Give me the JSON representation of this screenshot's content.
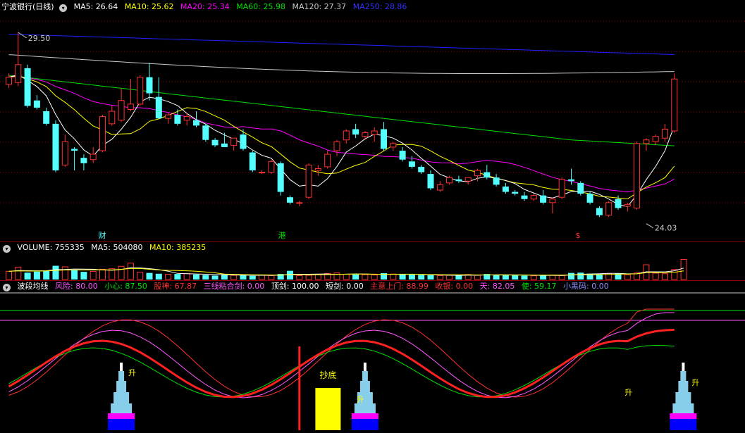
{
  "colors": {
    "bg": "#000000",
    "up": "#ff3232",
    "down": "#54ffff",
    "grid": "#8b0000",
    "ma5": "#ffffff",
    "ma10": "#ffff00",
    "ma20": "#ff00ff",
    "ma60": "#00e000",
    "ma120": "#c8c8c8",
    "ma250": "#2020ff"
  },
  "price_panel": {
    "title": "宁波银行(日线)",
    "menu_icon": "chevron-down-icon",
    "ma": [
      {
        "label": "MA5: 26.64",
        "color": "#ffffff"
      },
      {
        "label": "MA10: 25.62",
        "color": "#ffff00"
      },
      {
        "label": "MA20: 25.34",
        "color": "#ff00ff"
      },
      {
        "label": "MA60: 25.98",
        "color": "#00e000"
      },
      {
        "label": "MA120: 27.37",
        "color": "#c8c8c8"
      },
      {
        "label": "MA250: 28.86",
        "color": "#3232ff"
      }
    ],
    "high_label": "29.50",
    "low_label": "24.03",
    "markers": [
      {
        "text": "财",
        "color": "#54ffff",
        "day": 0.125
      },
      {
        "text": "港",
        "color": "#00e000",
        "day": 0.38
      },
      {
        "text": "$",
        "color": "#ff3232",
        "day": 0.8
      }
    ],
    "candles": [
      {
        "o": 28.05,
        "h": 28.35,
        "l": 27.95,
        "c": 28.25
      },
      {
        "o": 28.1,
        "h": 29.5,
        "l": 28.0,
        "c": 28.6
      },
      {
        "o": 28.5,
        "h": 28.6,
        "l": 27.4,
        "c": 27.45
      },
      {
        "o": 27.6,
        "h": 27.75,
        "l": 27.35,
        "c": 27.4
      },
      {
        "o": 27.3,
        "h": 27.4,
        "l": 26.9,
        "c": 26.95
      },
      {
        "o": 26.95,
        "h": 27.05,
        "l": 25.6,
        "c": 25.65
      },
      {
        "o": 25.8,
        "h": 26.65,
        "l": 25.75,
        "c": 26.45
      },
      {
        "o": 26.25,
        "h": 26.3,
        "l": 25.65,
        "c": 26.2
      },
      {
        "o": 26.0,
        "h": 26.1,
        "l": 25.65,
        "c": 25.85
      },
      {
        "o": 25.95,
        "h": 26.3,
        "l": 25.85,
        "c": 26.1
      },
      {
        "o": 26.2,
        "h": 27.2,
        "l": 26.15,
        "c": 27.15
      },
      {
        "o": 26.95,
        "h": 27.45,
        "l": 26.9,
        "c": 27.3
      },
      {
        "o": 27.05,
        "h": 27.95,
        "l": 27.0,
        "c": 27.6
      },
      {
        "o": 27.35,
        "h": 28.2,
        "l": 27.3,
        "c": 27.5
      },
      {
        "o": 27.5,
        "h": 28.3,
        "l": 27.45,
        "c": 28.25
      },
      {
        "o": 28.25,
        "h": 28.65,
        "l": 27.6,
        "c": 27.8
      },
      {
        "o": 27.7,
        "h": 28.25,
        "l": 27.1,
        "c": 27.1
      },
      {
        "o": 27.1,
        "h": 27.25,
        "l": 26.95,
        "c": 27.2
      },
      {
        "o": 27.2,
        "h": 27.35,
        "l": 26.9,
        "c": 26.95
      },
      {
        "o": 27.05,
        "h": 27.25,
        "l": 26.9,
        "c": 27.15
      },
      {
        "o": 27.05,
        "h": 27.3,
        "l": 26.85,
        "c": 26.9
      },
      {
        "o": 26.9,
        "h": 26.95,
        "l": 26.45,
        "c": 26.5
      },
      {
        "o": 26.5,
        "h": 26.55,
        "l": 26.3,
        "c": 26.35
      },
      {
        "o": 26.4,
        "h": 26.7,
        "l": 26.3,
        "c": 26.3
      },
      {
        "o": 26.35,
        "h": 26.55,
        "l": 26.2,
        "c": 26.55
      },
      {
        "o": 26.65,
        "h": 26.8,
        "l": 26.2,
        "c": 26.25
      },
      {
        "o": 26.15,
        "h": 26.2,
        "l": 25.6,
        "c": 25.65
      },
      {
        "o": 25.6,
        "h": 25.65,
        "l": 25.55,
        "c": 25.6
      },
      {
        "o": 25.6,
        "h": 25.95,
        "l": 25.55,
        "c": 25.9
      },
      {
        "o": 25.85,
        "h": 25.9,
        "l": 24.95,
        "c": 25.05
      },
      {
        "o": 24.9,
        "h": 24.95,
        "l": 24.7,
        "c": 24.75
      },
      {
        "o": 24.75,
        "h": 24.8,
        "l": 24.65,
        "c": 24.75
      },
      {
        "o": 24.9,
        "h": 25.85,
        "l": 24.85,
        "c": 25.8
      },
      {
        "o": 25.65,
        "h": 25.8,
        "l": 25.5,
        "c": 25.7
      },
      {
        "o": 25.75,
        "h": 26.2,
        "l": 25.7,
        "c": 26.1
      },
      {
        "o": 26.2,
        "h": 26.5,
        "l": 26.05,
        "c": 26.45
      },
      {
        "o": 26.5,
        "h": 26.8,
        "l": 26.4,
        "c": 26.75
      },
      {
        "o": 26.8,
        "h": 26.95,
        "l": 26.55,
        "c": 26.65
      },
      {
        "o": 26.6,
        "h": 26.75,
        "l": 26.5,
        "c": 26.7
      },
      {
        "o": 26.65,
        "h": 26.85,
        "l": 26.45,
        "c": 26.75
      },
      {
        "o": 26.8,
        "h": 27.0,
        "l": 26.2,
        "c": 26.25
      },
      {
        "o": 26.3,
        "h": 26.45,
        "l": 26.2,
        "c": 26.4
      },
      {
        "o": 26.2,
        "h": 26.3,
        "l": 25.9,
        "c": 25.95
      },
      {
        "o": 25.9,
        "h": 26.05,
        "l": 25.7,
        "c": 25.75
      },
      {
        "o": 25.75,
        "h": 25.8,
        "l": 25.55,
        "c": 25.6
      },
      {
        "o": 25.55,
        "h": 25.65,
        "l": 25.1,
        "c": 25.15
      },
      {
        "o": 25.1,
        "h": 25.35,
        "l": 25.05,
        "c": 25.25
      },
      {
        "o": 25.3,
        "h": 25.5,
        "l": 25.25,
        "c": 25.45
      },
      {
        "o": 25.4,
        "h": 25.5,
        "l": 25.3,
        "c": 25.35
      },
      {
        "o": 25.35,
        "h": 25.45,
        "l": 25.25,
        "c": 25.45
      },
      {
        "o": 25.5,
        "h": 25.7,
        "l": 25.35,
        "c": 25.65
      },
      {
        "o": 25.6,
        "h": 25.8,
        "l": 25.4,
        "c": 25.45
      },
      {
        "o": 25.45,
        "h": 25.55,
        "l": 25.2,
        "c": 25.25
      },
      {
        "o": 25.2,
        "h": 25.3,
        "l": 25.0,
        "c": 25.05
      },
      {
        "o": 25.05,
        "h": 25.1,
        "l": 24.95,
        "c": 25.0
      },
      {
        "o": 24.95,
        "h": 25.05,
        "l": 24.8,
        "c": 24.85
      },
      {
        "o": 24.85,
        "h": 25.0,
        "l": 24.8,
        "c": 24.95
      },
      {
        "o": 24.95,
        "h": 25.1,
        "l": 24.7,
        "c": 24.75
      },
      {
        "o": 24.75,
        "h": 24.9,
        "l": 24.45,
        "c": 24.85
      },
      {
        "o": 24.9,
        "h": 25.45,
        "l": 24.85,
        "c": 25.4
      },
      {
        "o": 25.4,
        "h": 25.7,
        "l": 25.25,
        "c": 25.35
      },
      {
        "o": 25.3,
        "h": 25.35,
        "l": 24.95,
        "c": 25.0
      },
      {
        "o": 25.0,
        "h": 25.05,
        "l": 24.7,
        "c": 24.75
      },
      {
        "o": 24.6,
        "h": 24.65,
        "l": 24.35,
        "c": 24.4
      },
      {
        "o": 24.4,
        "h": 24.8,
        "l": 24.35,
        "c": 24.75
      },
      {
        "o": 24.85,
        "h": 24.95,
        "l": 24.55,
        "c": 24.6
      },
      {
        "o": 24.65,
        "h": 24.75,
        "l": 24.5,
        "c": 24.7
      },
      {
        "o": 24.6,
        "h": 26.45,
        "l": 24.55,
        "c": 26.4
      },
      {
        "o": 26.4,
        "h": 26.55,
        "l": 26.2,
        "c": 26.5
      },
      {
        "o": 26.45,
        "h": 26.65,
        "l": 26.35,
        "c": 26.6
      },
      {
        "o": 26.55,
        "h": 26.95,
        "l": 26.45,
        "c": 26.8
      },
      {
        "o": 26.75,
        "h": 28.35,
        "l": 26.7,
        "c": 28.2
      }
    ]
  },
  "volume_panel": {
    "title": "VOLUME: 755335",
    "ma5": "MA5: 504080",
    "ma10": "MA10: 385235",
    "values": [
      310,
      470,
      260,
      300,
      330,
      520,
      480,
      350,
      290,
      310,
      390,
      410,
      500,
      620,
      280,
      250,
      220,
      200,
      210,
      230,
      190,
      170,
      150,
      180,
      160,
      170,
      140,
      160,
      150,
      210,
      330,
      150,
      160,
      180,
      230,
      250,
      200,
      190,
      180,
      170,
      240,
      210,
      190,
      180,
      170,
      160,
      150,
      160,
      150,
      190,
      160,
      210,
      180,
      170,
      160,
      150,
      140,
      160,
      170,
      150,
      250,
      260,
      220,
      210,
      230,
      240,
      180,
      250,
      560,
      240,
      220,
      380,
      760
    ]
  },
  "indicator_panel": {
    "name": "波段均线",
    "items": [
      {
        "label": "风险: 80.00",
        "color": "#ff55ff"
      },
      {
        "label": "小心: 87.50",
        "color": "#00e000"
      },
      {
        "label": "股神: 67.87",
        "color": "#ff3232"
      },
      {
        "label": "三线粘合剑: 0.00",
        "color": "#ff55ff"
      },
      {
        "label": "顶剑: 100.00",
        "color": "#ffffff"
      },
      {
        "label": "短剑: 0.00",
        "color": "#ffffff"
      },
      {
        "label": "主意上门: 88.99",
        "color": "#ff3232"
      },
      {
        "label": "收银: 0.00",
        "color": "#ff3232"
      },
      {
        "label": "天: 82.05",
        "color": "#ff55ff"
      },
      {
        "label": "使: 59.17",
        "color": "#00e000"
      },
      {
        "label": "小黑码: 0.00",
        "color": "#9090ff"
      }
    ],
    "signal_labels": [
      "升",
      "升",
      "升",
      "升"
    ],
    "bottom_label": "抄底"
  }
}
